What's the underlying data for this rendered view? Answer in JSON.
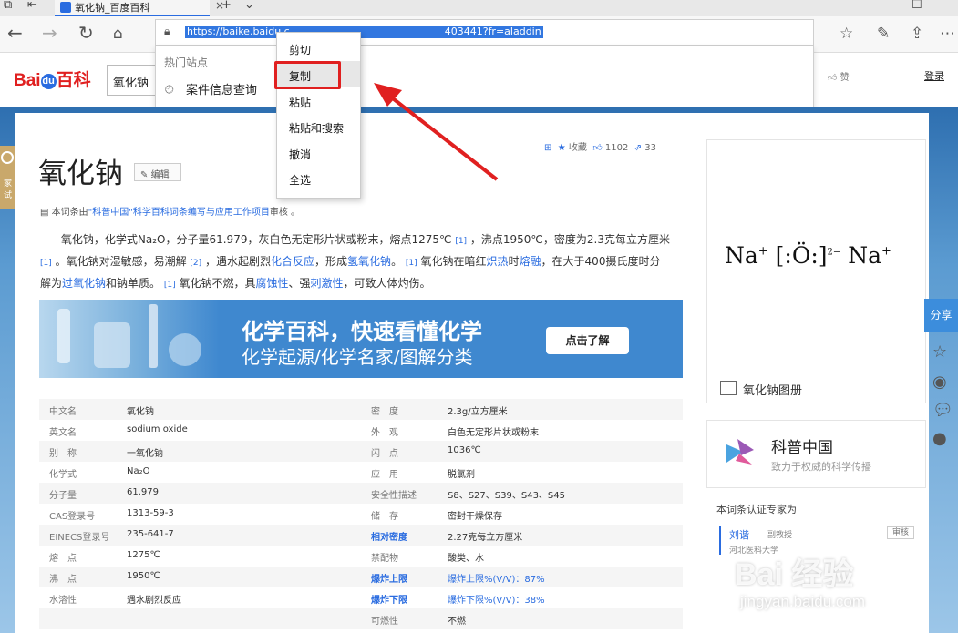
{
  "browser": {
    "tab_title": "氧化钠_百度百科",
    "url": "https://baike.baidu.com/item/%E6%B0%A7%E5%8C%96%E9%92%A0/403441?fr=aladdin",
    "url_visible": "https://baike.baidu.c",
    "url_visible_tail": "403441?fr=aladdin",
    "dropdown_section": "热门站点",
    "dropdown_history": "案件信息查询"
  },
  "context_menu": {
    "items": [
      "剪切",
      "复制",
      "粘贴",
      "粘贴和搜索",
      "撤消",
      "全选"
    ],
    "highlighted": "复制",
    "highlight_color": "#e02020"
  },
  "header": {
    "logo_left": "Bai",
    "logo_du": "du",
    "logo_right": "百科",
    "search_value": "氧化钠",
    "like": "赞",
    "login": "登录"
  },
  "article": {
    "title": "氧化钠",
    "edit_label": "编辑",
    "collect_label": "收藏",
    "likes": "1102",
    "shares": "33",
    "lefttab_label": "家 试",
    "note_prefix": "本词条由",
    "note_link": "\"科普中国\"科学百科词条编写与应用工作项目",
    "note_suffix": "审核 。",
    "para_1": "氧化钠，化学式Na₂O，分子量61.979，灰白色无定形片状或粉末，熔点1275℃",
    "para_1b": "，沸点1950℃，密度为2.3克每立方厘米",
    "para_2a": "。氧化钠对湿敏感，易潮解",
    "para_2b": "，遇水起剧烈",
    "para_2link": "化合反应",
    "para_2c": "，形成",
    "para_2link2": "氢氧化钠",
    "para_2d": "。",
    "para_2e": "氧化钠在暗红",
    "para_2link3": "炽热",
    "para_2f": "时",
    "para_2link4": "熔融",
    "para_2g": "，在大于400摄氏度时分",
    "para_3a": "解为",
    "para_3link": "过氧化钠",
    "para_3b": "和钠单质。",
    "para_3c": "氧化钠不燃，具",
    "para_3link2": "腐蚀性",
    "para_3d": "、强",
    "para_3link3": "刺激性",
    "para_3e": "，可致人体灼伤。",
    "ref_mark": "[1]",
    "ref_mark2": "[2]"
  },
  "banner": {
    "line1": "化学百科，快速看懂化学",
    "line2": "化学起源/化学名家/图解分类",
    "button": "点击了解"
  },
  "infobox": {
    "left": [
      {
        "k": "中文名",
        "v": "氧化钠"
      },
      {
        "k": "英文名",
        "v": "sodium oxide"
      },
      {
        "k": "别　称",
        "v": "一氧化钠"
      },
      {
        "k": "化学式",
        "v": "Na₂O"
      },
      {
        "k": "分子量",
        "v": "61.979"
      },
      {
        "k": "CAS登录号",
        "v": "1313-59-3"
      },
      {
        "k": "EINECS登录号",
        "v": "235-641-7"
      },
      {
        "k": "熔　点",
        "v": "1275℃"
      },
      {
        "k": "沸　点",
        "v": "1950℃"
      },
      {
        "k": "水溶性",
        "v": "遇水剧烈反应"
      }
    ],
    "right": [
      {
        "k": "密　度",
        "v": "2.3g/立方厘米"
      },
      {
        "k": "外　观",
        "v": "白色无定形片状或粉末"
      },
      {
        "k": "闪　点",
        "v": "1036℃"
      },
      {
        "k": "应　用",
        "v": "脱氯剂"
      },
      {
        "k": "安全性描述",
        "v": "S8、S27、S39、S43、S45"
      },
      {
        "k": "储　存",
        "v": "密封干燥保存"
      },
      {
        "k": "相对密度",
        "v": "2.27克每立方厘米"
      },
      {
        "k": "禁配物",
        "v": "酸类、水"
      },
      {
        "k": "爆炸上限",
        "v": "爆炸上限%(V/V)：87%"
      },
      {
        "k": "爆炸下限",
        "v": "爆炸下限%(V/V)：38%"
      },
      {
        "k": "可燃性",
        "v": "不燃"
      }
    ]
  },
  "sidebar": {
    "formula_na1": "Na",
    "formula_plus1": "+",
    "formula_mid": "[:Ö:]",
    "formula_charge": "2−",
    "formula_na2": "Na",
    "formula_plus2": "+",
    "album_label": "氧化钠图册",
    "kp_name": "科普中国",
    "kp_slogan": "致力于权威的科学传播",
    "expert_heading": "本词条认证专家为",
    "expert_name": "刘谐",
    "expert_role": "副教授",
    "expert_org": "河北医科大学",
    "audit": "审核",
    "share": "分享"
  },
  "watermark": {
    "brand": "Bai 经验",
    "url": "jingyan.baidu.com"
  }
}
